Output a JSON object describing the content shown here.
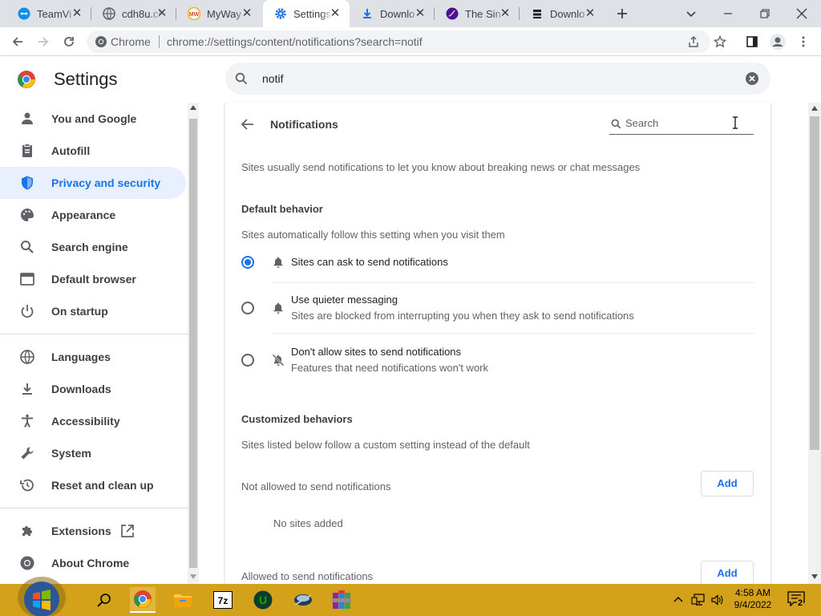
{
  "browser": {
    "tabs": [
      {
        "title": "TeamVi",
        "icon": "teamviewer-icon",
        "active": false
      },
      {
        "title": "cdh8u.cl",
        "icon": "globe-icon",
        "active": false
      },
      {
        "title": "MyWay",
        "icon": "myway-icon",
        "active": false
      },
      {
        "title": "Settings",
        "icon": "settings-gear-icon",
        "active": true
      },
      {
        "title": "Downlo",
        "icon": "download-icon",
        "active": false
      },
      {
        "title": "The Sin",
        "icon": "purple-circle-icon",
        "active": false
      },
      {
        "title": "Downlo",
        "icon": "download-site-icon",
        "active": false
      }
    ],
    "tab_close_glyph": "✕",
    "omnibox": {
      "site_label": "Chrome",
      "url": "chrome://settings/content/notifications?search=notif"
    }
  },
  "settings": {
    "title": "Settings",
    "search_query": "notif",
    "sidebar": [
      {
        "label": "You and Google",
        "icon": "person-icon"
      },
      {
        "label": "Autofill",
        "icon": "clipboard-icon"
      },
      {
        "label": "Privacy and security",
        "icon": "shield-icon",
        "selected": true
      },
      {
        "label": "Appearance",
        "icon": "palette-icon"
      },
      {
        "label": "Search engine",
        "icon": "search-icon"
      },
      {
        "label": "Default browser",
        "icon": "browser-window-icon"
      },
      {
        "label": "On startup",
        "icon": "power-icon"
      },
      {
        "label": "Languages",
        "icon": "globe-icon"
      },
      {
        "label": "Downloads",
        "icon": "download-icon"
      },
      {
        "label": "Accessibility",
        "icon": "accessibility-icon"
      },
      {
        "label": "System",
        "icon": "wrench-icon"
      },
      {
        "label": "Reset and clean up",
        "icon": "restore-icon"
      },
      {
        "label": "Extensions",
        "icon": "puzzle-icon"
      },
      {
        "label": "About Chrome",
        "icon": "chrome-icon"
      }
    ]
  },
  "notifications": {
    "title": "Notifications",
    "search_placeholder": "Search",
    "description": "Sites usually send notifications to let you know about breaking news or chat messages",
    "default_behavior": {
      "heading": "Default behavior",
      "subheading": "Sites automatically follow this setting when you visit them",
      "options": [
        {
          "label": "Sites can ask to send notifications",
          "sublabel": "",
          "selected": true,
          "icon": "bell-icon"
        },
        {
          "label": "Use quieter messaging",
          "sublabel": "Sites are blocked from interrupting you when they ask to send notifications",
          "selected": false,
          "icon": "bell-icon"
        },
        {
          "label": "Don't allow sites to send notifications",
          "sublabel": "Features that need notifications won't work",
          "selected": false,
          "icon": "bell-off-icon"
        }
      ]
    },
    "customized": {
      "heading": "Customized behaviors",
      "subheading": "Sites listed below follow a custom setting instead of the default",
      "not_allowed_label": "Not allowed to send notifications",
      "add_label": "Add",
      "no_sites": "No sites added",
      "allowed_label": "Allowed to send notifications",
      "add_label_2": "Add"
    }
  },
  "taskbar": {
    "time": "4:58 AM",
    "date": "9/4/2022",
    "notification_count": "2",
    "apps": [
      "start-orb-icon",
      "search-icon",
      "chrome-icon",
      "file-explorer-icon",
      "7zip-icon",
      "upwork-icon",
      "network-drive-icon",
      "winrar-icon"
    ]
  },
  "colors": {
    "accent": "#1a73e8",
    "taskbar": "#d4a21a",
    "tabstrip": "#dee1e6"
  }
}
